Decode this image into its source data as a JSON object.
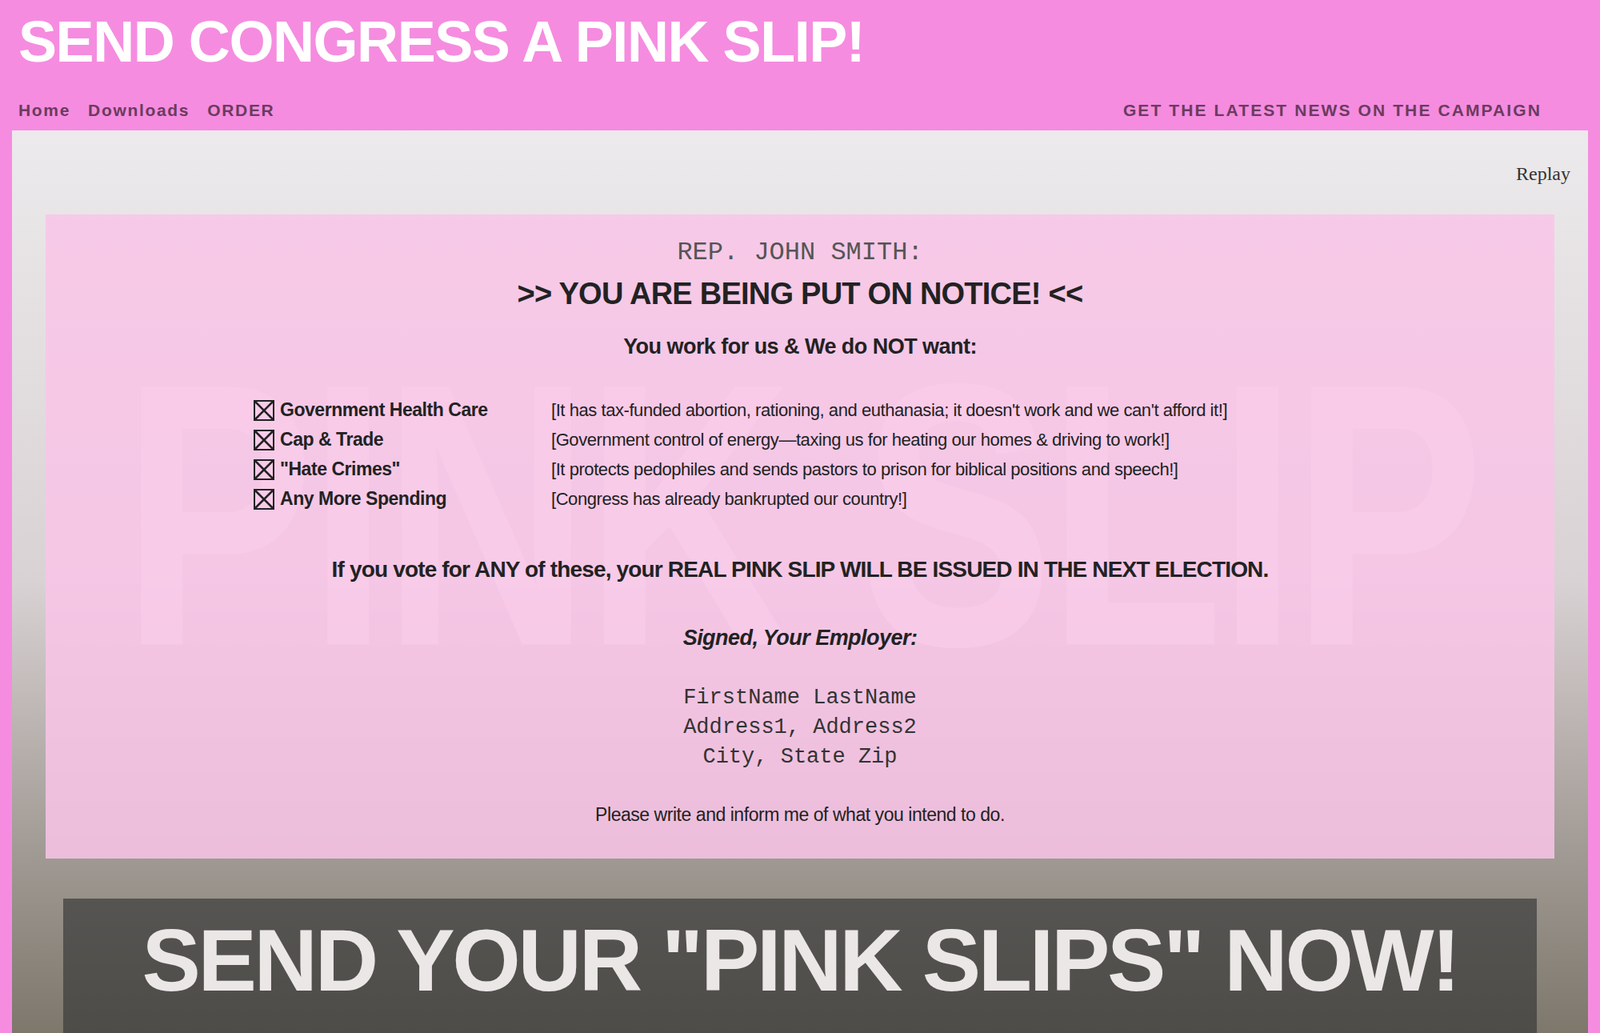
{
  "header": {
    "title": "SEND CONGRESS A PINK SLIP!",
    "nav": [
      {
        "label": "Home"
      },
      {
        "label": "Downloads"
      },
      {
        "label": "ORDER"
      }
    ],
    "news_link": "GET THE LATEST NEWS ON THE CAMPAIGN"
  },
  "replay": "Replay",
  "watermark": "PINK SLIP",
  "notice": {
    "addressee": "REP. JOHN SMITH:",
    "headline": ">> YOU ARE BEING PUT ON NOTICE! <<",
    "intro": "You work for us & We do NOT want:",
    "items": [
      {
        "label": "Government Health Care",
        "reason": "[It has tax-funded abortion, rationing, and euthanasia; it doesn't work and we can't afford it!]",
        "checked": true
      },
      {
        "label": "Cap & Trade",
        "reason": "[Government control of energy—taxing us for heating our homes & driving to work!]",
        "checked": true
      },
      {
        "label": "\"Hate Crimes\"",
        "reason": "[It protects pedophiles and sends pastors to prison for biblical positions and speech!]",
        "checked": true
      },
      {
        "label": "Any More Spending",
        "reason": "[Congress has already bankrupted our country!]",
        "checked": true
      }
    ],
    "warning": "If you vote for ANY of these, your REAL PINK SLIP WILL BE ISSUED IN THE NEXT ELECTION.",
    "signature": "Signed, Your Employer:",
    "address_lines": [
      "FirstName LastName",
      "Address1, Address2",
      "City, State Zip"
    ],
    "closing": "Please write and inform me of what you intend to do."
  },
  "banner": "SEND YOUR \"PINK SLIPS\" NOW!"
}
